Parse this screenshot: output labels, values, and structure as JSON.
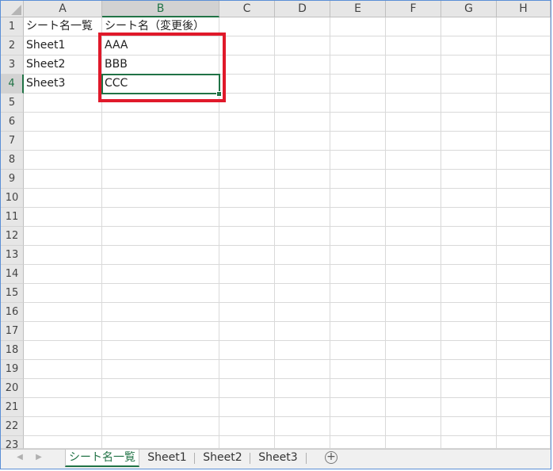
{
  "columns": [
    "A",
    "B",
    "C",
    "D",
    "E",
    "F",
    "G",
    "H"
  ],
  "active_column": "B",
  "rows": [
    "1",
    "2",
    "3",
    "4",
    "5",
    "6",
    "7",
    "8",
    "9",
    "10",
    "11",
    "12",
    "13",
    "14",
    "15",
    "16",
    "17",
    "18",
    "19",
    "20",
    "21",
    "22",
    "23"
  ],
  "active_row": "4",
  "cells": {
    "A1": "シート名一覧",
    "B1": "シート名（変更後）",
    "A2": "Sheet1",
    "B2": "AAA",
    "A3": "Sheet2",
    "B3": "BBB",
    "A4": "Sheet3",
    "B4": "CCC"
  },
  "tabs": [
    {
      "label": "シート名一覧",
      "active": true
    },
    {
      "label": "Sheet1",
      "active": false
    },
    {
      "label": "Sheet2",
      "active": false
    },
    {
      "label": "Sheet3",
      "active": false
    }
  ],
  "add_sheet_symbol": "+",
  "nav": {
    "prev": "◀",
    "next": "▶"
  },
  "colors": {
    "accent": "#217346",
    "highlight": "#e0192a",
    "grid": "#d9d9d9"
  }
}
